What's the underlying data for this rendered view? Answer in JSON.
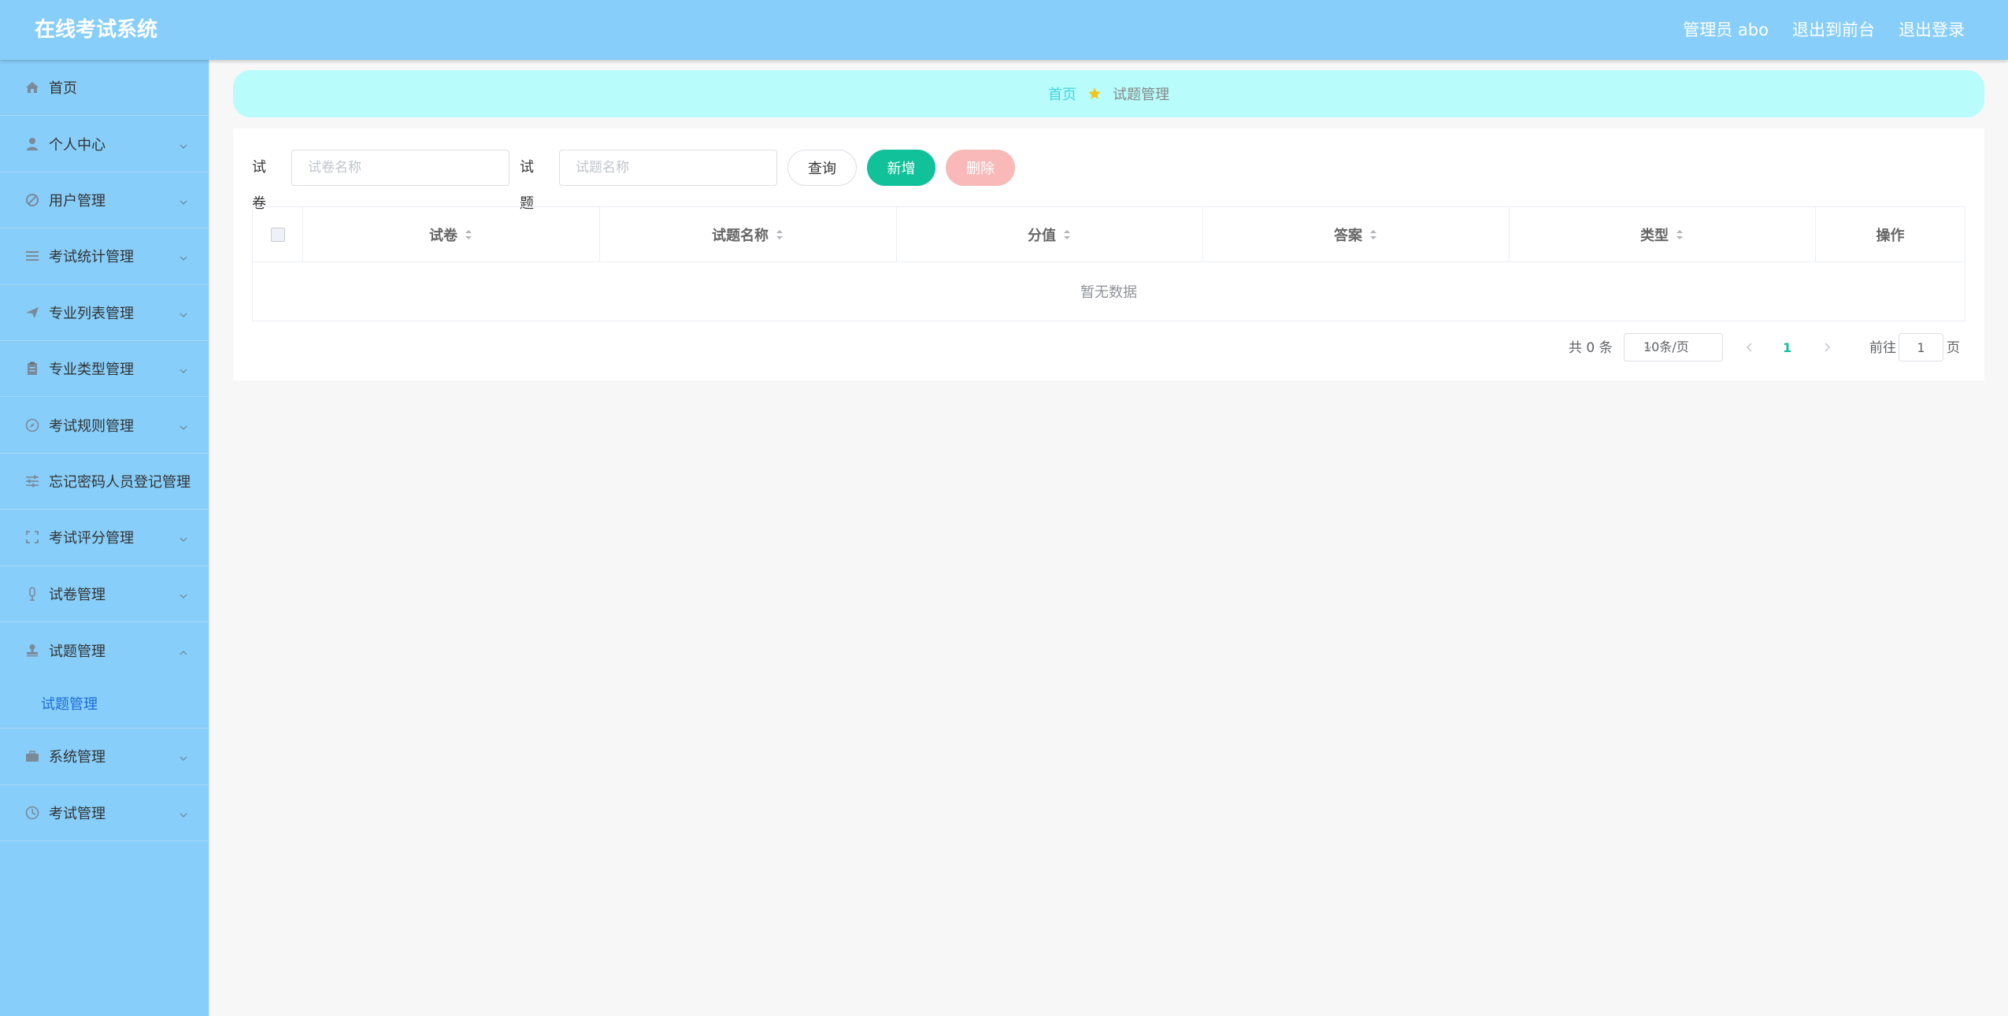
{
  "app": {
    "title": "在线考试系统"
  },
  "header": {
    "user_label": "管理员 abo",
    "to_front_label": "退出到前台",
    "logout_label": "退出登录"
  },
  "colors": {
    "header_bg": "#87cefa",
    "sidebar_bg": "#87cefa",
    "breadcrumb_bg": "#b8fcfc",
    "primary": "#11c19a",
    "danger_disabled": "#f9b9b9",
    "link_active": "#1e6bd6"
  },
  "sidebar": {
    "items": [
      {
        "label": "首页",
        "icon": "home-icon",
        "expandable": false
      },
      {
        "label": "个人中心",
        "icon": "user-icon",
        "expandable": true
      },
      {
        "label": "用户管理",
        "icon": "ban-icon",
        "expandable": true
      },
      {
        "label": "考试统计管理",
        "icon": "list-icon",
        "expandable": true
      },
      {
        "label": "专业列表管理",
        "icon": "paper-plane-icon",
        "expandable": true
      },
      {
        "label": "专业类型管理",
        "icon": "clipboard-icon",
        "expandable": true
      },
      {
        "label": "考试规则管理",
        "icon": "compass-icon",
        "expandable": true
      },
      {
        "label": "忘记密码人员登记管理",
        "icon": "sliders-icon",
        "expandable": true
      },
      {
        "label": "考试评分管理",
        "icon": "fullscreen-icon",
        "expandable": true
      },
      {
        "label": "试卷管理",
        "icon": "microphone-icon",
        "expandable": true
      },
      {
        "label": "试题管理",
        "icon": "stamp-icon",
        "expandable": true,
        "expanded": true
      },
      {
        "label": "系统管理",
        "icon": "briefcase-icon",
        "expandable": true
      },
      {
        "label": "考试管理",
        "icon": "clock-icon",
        "expandable": true
      }
    ],
    "submenu": {
      "label": "试题管理"
    }
  },
  "breadcrumb": {
    "home": "首页",
    "current": "试题管理",
    "separator_icon": "star-icon"
  },
  "search": {
    "paper_label": "试卷",
    "paper_placeholder": "试卷名称",
    "question_label": "试题",
    "question_placeholder": "试题名称",
    "query_button": "查询",
    "add_button": "新增",
    "delete_button": "删除"
  },
  "table": {
    "columns": [
      "试卷",
      "试题名称",
      "分值",
      "答案",
      "类型",
      "操作"
    ],
    "sortable": [
      true,
      true,
      true,
      true,
      true,
      false
    ],
    "rows": [],
    "empty_text": "暂无数据"
  },
  "pagination": {
    "total_text": "共 0 条",
    "page_size": "10条/页",
    "current_page": "1",
    "goto_label": "前往",
    "goto_value": "1",
    "page_unit": "页"
  }
}
